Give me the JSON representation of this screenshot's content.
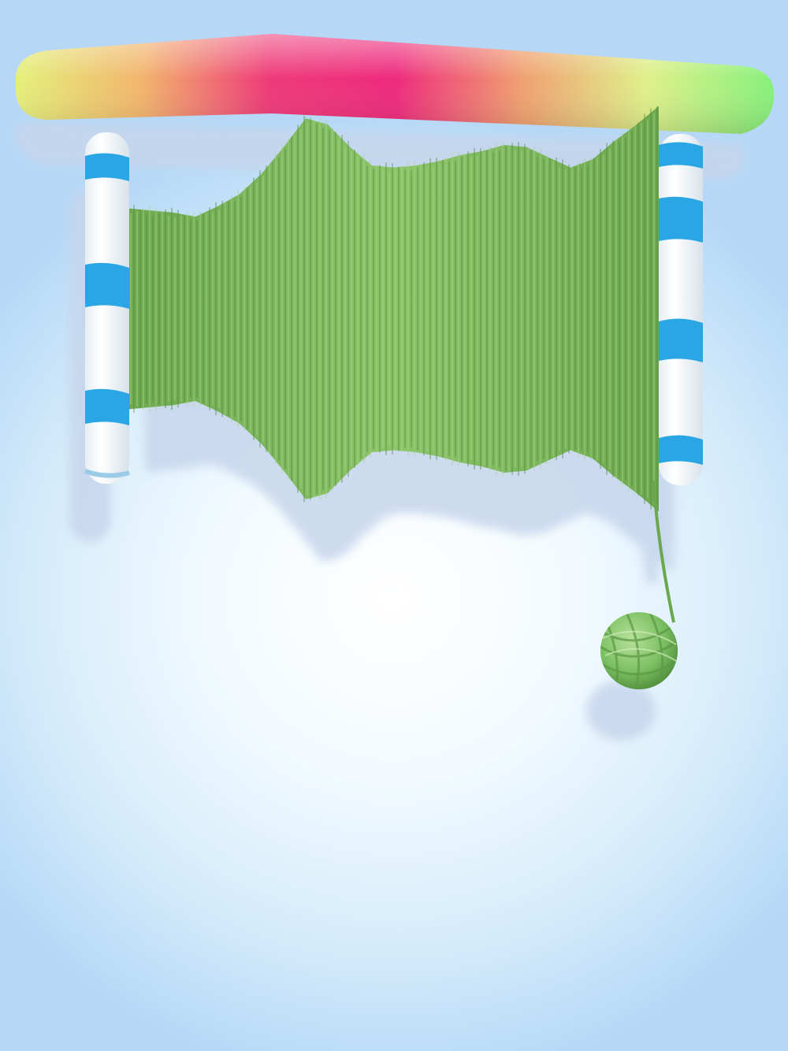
{
  "scene": {
    "background": {
      "center": "#ffffff",
      "edge": "#b6d8f6"
    },
    "top_bar": {
      "name": "color-gradient-bar",
      "colors": [
        "#e4f07a",
        "#f2b46c",
        "#ee3a78",
        "#ee2a7c",
        "#f0a070",
        "#dff08a",
        "#86f07a"
      ]
    },
    "spool": {
      "frame": "#ffffff",
      "stripe": "#2aa6e4",
      "yarn_color": "#7fb85e",
      "yarn_dark": "#4f8a38",
      "yarn_light": "#a8d488",
      "profile": [
        0.49,
        0.48,
        0.47,
        0.45,
        0.5,
        0.56,
        0.66,
        0.79,
        0.93,
        0.9,
        0.79,
        0.7,
        0.69,
        0.7,
        0.72,
        0.75,
        0.77,
        0.8,
        0.79,
        0.74,
        0.69,
        0.73,
        0.82,
        0.9,
        0.99
      ]
    },
    "yarn_ball": {
      "color": "#7cc063"
    }
  }
}
